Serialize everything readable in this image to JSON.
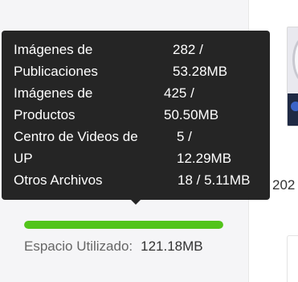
{
  "tooltip": {
    "rows": [
      {
        "label_lines": [
          "Imágenes de",
          "Publicaciones"
        ],
        "value_lines": [
          "282 /",
          "53.28MB"
        ]
      },
      {
        "label_lines": [
          "Imágenes de",
          "Productos"
        ],
        "value_lines": [
          "425 /",
          "50.50MB"
        ]
      },
      {
        "label_lines": [
          "Centro de Videos de",
          "UP"
        ],
        "value_lines": [
          "5 /",
          "12.29MB"
        ]
      },
      {
        "label_lines": [
          "Otros Archivos"
        ],
        "value_lines": [
          "18 / 5.11MB"
        ]
      }
    ]
  },
  "storage": {
    "used_fraction": 1.0,
    "used_label": "Espacio Utilizado:",
    "used_value": "121.18MB",
    "bar_color": "#52c41a"
  },
  "right_panel": {
    "year_fragment": "202"
  }
}
